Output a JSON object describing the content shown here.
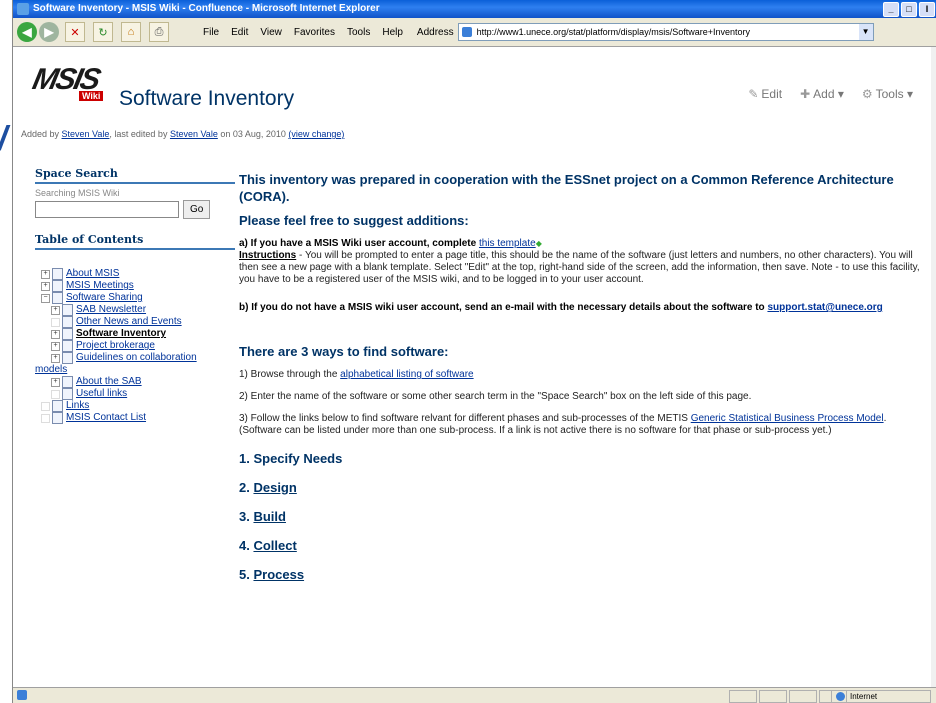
{
  "window": {
    "title": "Software Inventory - MSIS Wiki - Confluence - Microsoft Internet Explorer",
    "min_label": "_",
    "max_label": "□",
    "close_label": "I"
  },
  "toolbar": {
    "menu": [
      "File",
      "Edit",
      "View",
      "Favorites",
      "Tools",
      "Help"
    ],
    "address_label": "Address",
    "address_value": "http://www1.unece.org/stat/platform/display/msis/Software+Inventory",
    "icons": [
      "back-icon",
      "forward-icon",
      "stop-icon",
      "refresh-icon",
      "home-icon",
      "print-icon"
    ]
  },
  "header": {
    "logo_text": "MSIS",
    "logo_wiki": "Wiki",
    "page_title": "Software Inventory",
    "actions": [
      {
        "label": "Edit",
        "icon": "✎"
      },
      {
        "label": "Add ▾",
        "icon": "✚"
      },
      {
        "label": "Tools ▾",
        "icon": "⚙"
      }
    ],
    "byline_prefix": "Added by ",
    "byline_author": "Steven Vale",
    "byline_mid": ", last edited by ",
    "byline_editor": "Steven Vale",
    "byline_date": " on 03 Aug, 2010 ",
    "byline_change": "(view change)"
  },
  "sidebar": {
    "search_title": "Space Search",
    "search_sub": "Searching MSIS Wiki",
    "search_value": "",
    "go_label": "Go",
    "toc_title": "Table of Contents",
    "tree": [
      {
        "label": "About MSIS",
        "indent": 0,
        "exp": "+",
        "bold": false
      },
      {
        "label": "MSIS Meetings",
        "indent": 0,
        "exp": "+",
        "bold": false
      },
      {
        "label": "Software Sharing",
        "indent": 0,
        "exp": "−",
        "bold": false
      },
      {
        "label": "SAB Newsletter",
        "indent": 1,
        "exp": "+",
        "bold": false
      },
      {
        "label": "Other News and Events",
        "indent": 1,
        "exp": "",
        "bold": false
      },
      {
        "label": "Software Inventory",
        "indent": 1,
        "exp": "+",
        "bold": true
      },
      {
        "label": "Project brokerage",
        "indent": 1,
        "exp": "+",
        "bold": false
      },
      {
        "label": "Guidelines on collaboration",
        "indent": 1,
        "exp": "+",
        "bold": false
      },
      {
        "label": "models",
        "indent": -1,
        "exp": "",
        "bold": false,
        "cont": true
      },
      {
        "label": "About the SAB",
        "indent": 1,
        "exp": "+",
        "bold": false
      },
      {
        "label": "Useful links",
        "indent": 1,
        "exp": "",
        "bold": false
      },
      {
        "label": "Links",
        "indent": 0,
        "exp": "",
        "bold": false
      },
      {
        "label": "MSIS Contact List",
        "indent": 0,
        "exp": "",
        "bold": false
      }
    ]
  },
  "content": {
    "intro": "This inventory was prepared in cooperation with the ESSnet project on a Common Reference Architecture (CORA).",
    "suggest": "Please feel free to suggest additions:",
    "a_bold": "a) If you have a MSIS Wiki user account, complete ",
    "a_link": "this template",
    "instructions_label": "Instructions",
    "instructions_text": " - You will be prompted to enter a page title, this should be the name of the software (just letters and numbers, no other characters). You will then see a new page with a blank template. Select \"Edit\" at the top, right-hand side of the screen, add the information, then save. Note - to use this facility, you have to be a registered user of the MSIS wiki, and to be logged in to your user account.",
    "b_bold": "b) If you do not have a MSIS wiki user account, send an e-mail with the necessary details about the software to ",
    "b_link": "support.stat@unece.org",
    "ways_title": "There are 3 ways to find software:",
    "way1_prefix": "1) Browse through the ",
    "way1_link": "alphabetical listing of software",
    "way2": "2) Enter the name of the software or some other search term in the \"Space Search\" box on the left side of this page.",
    "way3_prefix": "3) Follow the links below to find software relvant for different phases and sub-processes of the METIS ",
    "way3_link": "Generic Statistical Business Process Model",
    "way3_suffix": ". (Software can be listed under more than one sub-process. If a link is not active there is no software for that phase or sub-process yet.)",
    "phases": [
      {
        "num": "1. ",
        "label": "Specify Needs",
        "link": false
      },
      {
        "num": "2. ",
        "label": "Design",
        "link": true
      },
      {
        "num": "3. ",
        "label": "Build",
        "link": true
      },
      {
        "num": "4. ",
        "label": "Collect",
        "link": true
      },
      {
        "num": "5. ",
        "label": "Process",
        "link": true
      }
    ]
  },
  "status": {
    "zone": "Internet"
  }
}
